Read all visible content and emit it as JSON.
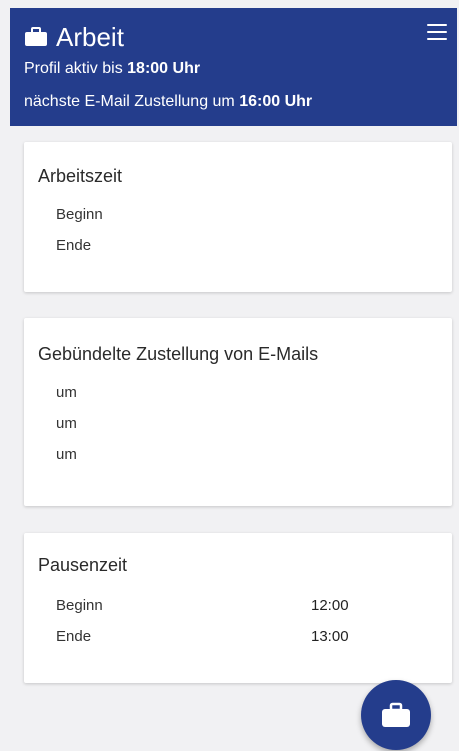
{
  "header": {
    "title": "Arbeit",
    "profile_prefix": "Profil aktiv bis ",
    "profile_time": "18:00 Uhr",
    "mail_prefix": "nächste E-Mail Zustellung um ",
    "mail_time": "16:00 Uhr",
    "title_icon": "briefcase-icon",
    "menu_icon": "hamburger-menu-icon"
  },
  "arbeitszeit": {
    "title": "Arbeitszeit",
    "rows": [
      {
        "label": "Beginn",
        "value": ""
      },
      {
        "label": "Ende",
        "value": ""
      }
    ]
  },
  "zustellung": {
    "title": "Gebündelte Zustellung von E-Mails",
    "rows": [
      {
        "label": "um",
        "value": ""
      },
      {
        "label": "um",
        "value": ""
      },
      {
        "label": "um",
        "value": ""
      }
    ]
  },
  "pausenzeit": {
    "title": "Pausenzeit",
    "rows": [
      {
        "label": "Beginn",
        "value": "12:00"
      },
      {
        "label": "Ende",
        "value": "13:00"
      }
    ]
  },
  "fab": {
    "icon": "briefcase-icon"
  },
  "colors": {
    "primary": "#243d8c",
    "background": "#f1f1f3",
    "card": "#ffffff"
  }
}
